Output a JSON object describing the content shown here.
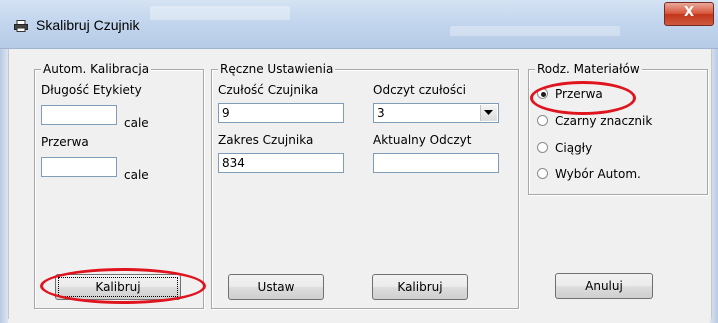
{
  "window": {
    "title": "Skalibruj Czujnik",
    "close_label": "X"
  },
  "auto_calibration": {
    "group_label": "Autom. Kalibracja",
    "label_length": "Długość Etykiety",
    "length_value": "",
    "length_unit": "cale",
    "label_gap": "Przerwa",
    "gap_value": "",
    "gap_unit": "cale",
    "calibrate_button": "Kalibruj"
  },
  "manual_settings": {
    "group_label": "Ręczne Ustawienia",
    "sensitivity_label": "Czułość Czujnika",
    "sensitivity_value": "9",
    "range_label": "Zakres Czujnika",
    "range_value": "834",
    "sensitivity_reading_label": "Odczyt czułości",
    "sensitivity_reading_selected": "3",
    "current_reading_label": "Aktualny Odczyt",
    "current_reading_value": "",
    "set_button": "Ustaw",
    "calibrate_button": "Kalibruj"
  },
  "material_type": {
    "group_label": "Rodz. Materiałów",
    "options": [
      {
        "label": "Przerwa",
        "selected": true
      },
      {
        "label": "Czarny znacznik",
        "selected": false
      },
      {
        "label": "Ciągły",
        "selected": false
      },
      {
        "label": "Wybór Autom.",
        "selected": false
      }
    ]
  },
  "footer": {
    "cancel_button": "Anuluj"
  },
  "colors": {
    "highlight": "#e0141e",
    "close_button": "#c2361b"
  }
}
